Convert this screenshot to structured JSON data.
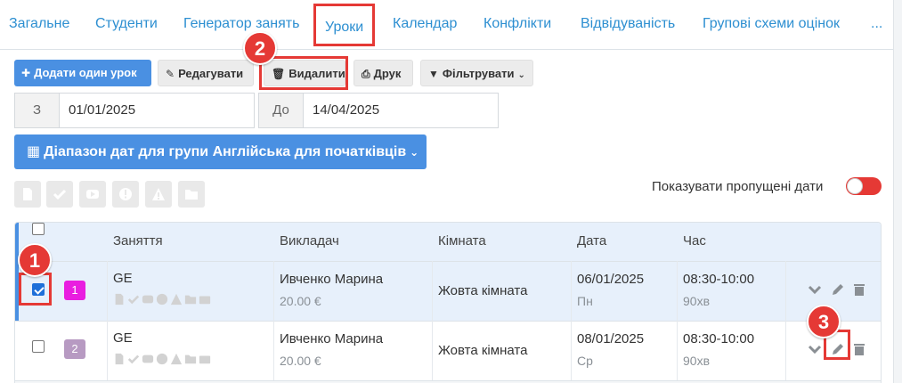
{
  "tabs": [
    {
      "label": "Загальне"
    },
    {
      "label": "Студенти"
    },
    {
      "label": "Генератор занять"
    },
    {
      "label": "Уроки"
    },
    {
      "label": "Календар"
    },
    {
      "label": "Конфлікти"
    },
    {
      "label": "Відвідуваність"
    },
    {
      "label": "Групові схеми оцінок"
    },
    {
      "label": "..."
    }
  ],
  "toolbar": {
    "add_label": "Додати один урок",
    "edit_label": "Редагувати",
    "delete_label": "Видалити",
    "print_label": "Друк",
    "filter_label": "Фільтрувати"
  },
  "date_range": {
    "from_prefix": "З",
    "from_value": "01/01/2025",
    "to_prefix": "До",
    "to_value": "14/04/2025"
  },
  "range_button": {
    "label": "Діапазон дат для групи Англійська для початківців"
  },
  "show_skipped": {
    "label": "Показувати пропущені дати"
  },
  "table": {
    "headers": {
      "lesson": "Заняття",
      "teacher": "Викладач",
      "room": "Кімната",
      "date": "Дата",
      "time": "Час"
    },
    "rows": [
      {
        "num": "1",
        "num_color": "#e91ee0",
        "lesson": "GE",
        "teacher": "Ивченко Марина",
        "price": "20.00 €",
        "room": "Жовта кімната",
        "date": "06/01/2025",
        "weekday": "Пн",
        "time": "08:30-10:00",
        "duration": "90хв",
        "checked": true
      },
      {
        "num": "2",
        "num_color": "#b79ac2",
        "lesson": "GE",
        "teacher": "Ивченко Марина",
        "price": "20.00 €",
        "room": "Жовта кімната",
        "date": "08/01/2025",
        "weekday": "Ср",
        "time": "08:30-10:00",
        "duration": "90хв",
        "checked": false
      }
    ]
  },
  "annotations": [
    {
      "label": "1"
    },
    {
      "label": "2"
    },
    {
      "label": "3"
    }
  ],
  "colors": {
    "primary": "#4a90e2",
    "accent": "#e53935",
    "link": "#2d8fd1"
  }
}
